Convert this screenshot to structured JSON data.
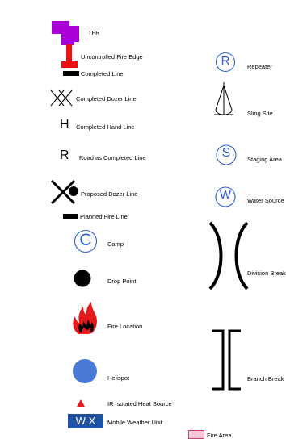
{
  "legend": {
    "colors": {
      "tfr": "#a800d6",
      "uncontrolled_edge": "#ee1111",
      "line_black": "#000000",
      "symbol_blue": "#2f5fd0",
      "helispot": "#4a78d6",
      "fire_red": "#e51b1b",
      "weather_bg": "#1f52a3",
      "fire_area_fill": "#f7c9d8",
      "fire_area_stroke": "#cc3f6e"
    },
    "items": [
      {
        "key": "tfr",
        "label": "TFR"
      },
      {
        "key": "uncontrolled_fire_edge",
        "label": "Uncontrolled Fire Edge"
      },
      {
        "key": "completed_line",
        "label": "Completed Line"
      },
      {
        "key": "completed_dozer_line",
        "label": "Completed Dozer Line"
      },
      {
        "key": "completed_hand_line",
        "label": "Completed Hand Line",
        "symbol": "H"
      },
      {
        "key": "road_as_completed_line",
        "label": "Road as Completed Line",
        "symbol": "R"
      },
      {
        "key": "proposed_dozer_line",
        "label": "Proposed Dozer Line"
      },
      {
        "key": "planned_fire_line",
        "label": "Planned Fire Line"
      },
      {
        "key": "camp",
        "label": "Camp",
        "symbol": "C"
      },
      {
        "key": "drop_point",
        "label": "Drop Point"
      },
      {
        "key": "fire_location",
        "label": "Fire Location"
      },
      {
        "key": "helispot",
        "label": "Helispot"
      },
      {
        "key": "ir_isolated_heat_source",
        "label": "IR Isolated Heat Source"
      },
      {
        "key": "mobile_weather_unit",
        "label": "Mobile Weather Unit",
        "symbol": "W X"
      },
      {
        "key": "fire_area",
        "label": "Fire Area"
      },
      {
        "key": "repeater",
        "label": "Repeater",
        "symbol": "R"
      },
      {
        "key": "sling_site",
        "label": "Sling Site"
      },
      {
        "key": "staging_area",
        "label": "Staging Area",
        "symbol": "S"
      },
      {
        "key": "water_source",
        "label": "Water Source",
        "symbol": "W"
      },
      {
        "key": "division_break",
        "label": "Division Break",
        "symbol": ")("
      },
      {
        "key": "branch_break",
        "label": "Branch Break",
        "symbol": "]["
      }
    ]
  }
}
